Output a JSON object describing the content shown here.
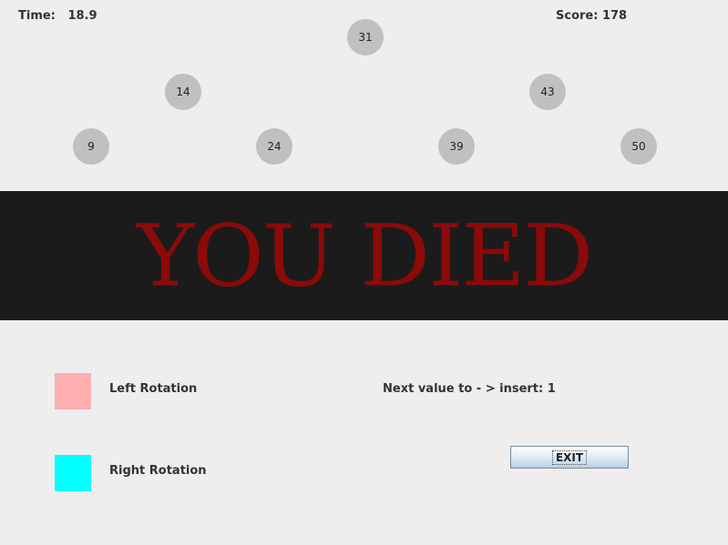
{
  "hud": {
    "time_label": "Time:",
    "time_value": "18.9",
    "score_label": "Score:",
    "score_value": "178"
  },
  "tree": {
    "nodes": [
      {
        "value": "31",
        "depth": 0
      },
      {
        "value": "14",
        "depth": 1
      },
      {
        "value": "43",
        "depth": 1
      },
      {
        "value": "9",
        "depth": 2
      },
      {
        "value": "24",
        "depth": 2
      },
      {
        "value": "39",
        "depth": 2
      },
      {
        "value": "50",
        "depth": 2
      }
    ],
    "node_color": "#c0c0c0"
  },
  "banner": {
    "text": "YOU DIED",
    "text_color": "#8b0a0a",
    "background_color": "#1b1b1b"
  },
  "legend": {
    "left_rotation_label": "Left Rotation",
    "left_rotation_color": "#ffafaf",
    "right_rotation_label": "Right Rotation",
    "right_rotation_color": "#00ffff"
  },
  "next_value": {
    "label": "Next value to - > insert:",
    "value": "1"
  },
  "exit_button": {
    "label": "EXIT"
  }
}
